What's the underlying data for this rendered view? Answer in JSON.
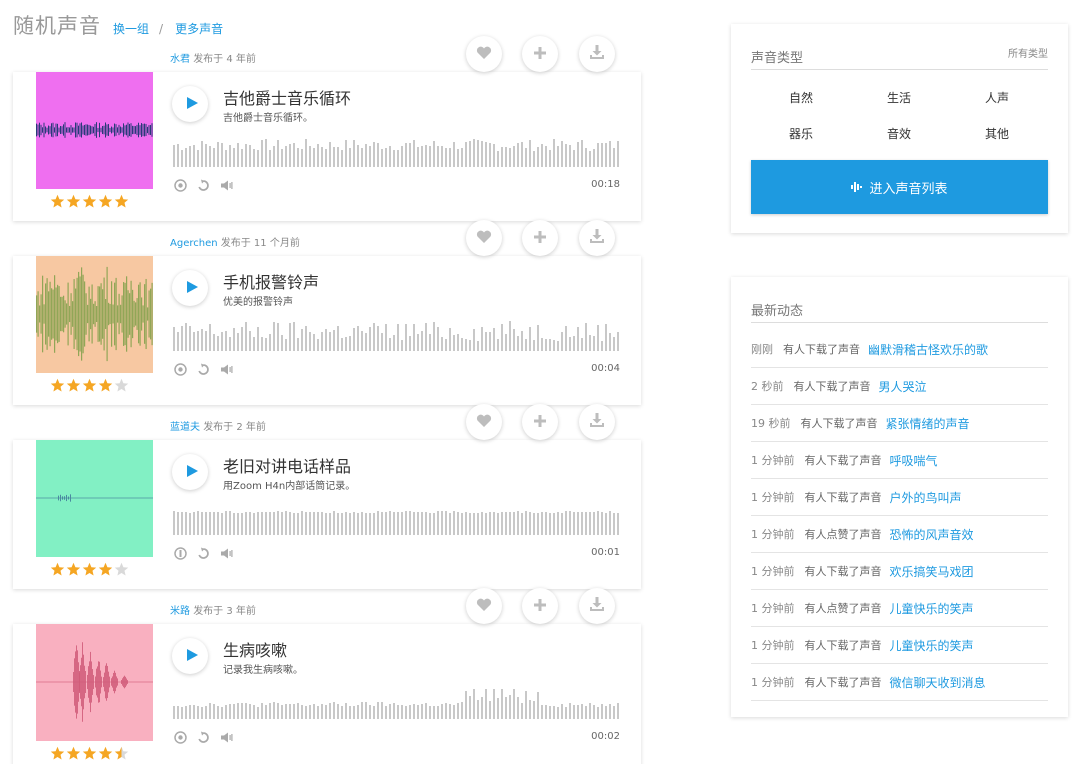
{
  "header": {
    "title": "随机声音",
    "switch_label": "换一组",
    "separator": "/",
    "more_label": "更多声音"
  },
  "sounds": [
    {
      "author": "水君",
      "published": "发布于 4 年前",
      "title": "吉他爵士音乐循环",
      "desc": "吉他爵士音乐循环。",
      "duration": "00:18",
      "rating": 5,
      "thumb_bg": "#ef6ff0",
      "wave_color": "#2a3a7a",
      "thumb_style": "flatline",
      "license_icon": "creative-commons-icon"
    },
    {
      "author": "Agerchen",
      "published": "发布于 11 个月前",
      "title": "手机报警铃声",
      "desc": "优美的报警铃声",
      "duration": "00:04",
      "rating": 4,
      "thumb_bg": "#f7c8a2",
      "wave_color": "#7fa04a",
      "thumb_style": "dense",
      "license_icon": "creative-commons-icon"
    },
    {
      "author": "蓝道夫",
      "published": "发布于 2 年前",
      "title": "老旧对讲电话样品",
      "desc": "用Zoom H4n内部话筒记录。",
      "duration": "00:01",
      "rating": 4,
      "thumb_bg": "#82f0c4",
      "wave_color": "#4a8aa0",
      "thumb_style": "thin",
      "license_icon": "attribution-icon"
    },
    {
      "author": "米路",
      "published": "发布于 3 年前",
      "title": "生病咳嗽",
      "desc": "记录我生病咳嗽。",
      "duration": "00:02",
      "rating": 4.5,
      "thumb_bg": "#f9b0c0",
      "wave_color": "#d05a78",
      "thumb_style": "spikes",
      "license_icon": "creative-commons-icon"
    }
  ],
  "types_panel": {
    "title": "声音类型",
    "all_label": "所有类型",
    "types": [
      "自然",
      "生活",
      "人声",
      "器乐",
      "音效",
      "其他"
    ],
    "enter_label": "进入声音列表"
  },
  "activity_panel": {
    "title": "最新动态",
    "items": [
      {
        "time": "刚刚",
        "action": "有人下载了声音",
        "sound": "幽默滑稽古怪欢乐的歌"
      },
      {
        "time": "2 秒前",
        "action": "有人下载了声音",
        "sound": "男人哭泣"
      },
      {
        "time": "19 秒前",
        "action": "有人下载了声音",
        "sound": "紧张情绪的声音"
      },
      {
        "time": "1 分钟前",
        "action": "有人下载了声音",
        "sound": "呼吸喘气"
      },
      {
        "time": "1 分钟前",
        "action": "有人下载了声音",
        "sound": "户外的鸟叫声"
      },
      {
        "time": "1 分钟前",
        "action": "有人点赞了声音",
        "sound": "恐怖的风声音效"
      },
      {
        "time": "1 分钟前",
        "action": "有人下载了声音",
        "sound": "欢乐搞笑马戏团"
      },
      {
        "time": "1 分钟前",
        "action": "有人点赞了声音",
        "sound": "儿童快乐的笑声"
      },
      {
        "time": "1 分钟前",
        "action": "有人下载了声音",
        "sound": "儿童快乐的笑声"
      },
      {
        "time": "1 分钟前",
        "action": "有人下载了声音",
        "sound": "微信聊天收到消息"
      }
    ]
  },
  "colors": {
    "accent": "#1e9ae0",
    "star": "#f5a623",
    "star_empty": "#d9d9d9",
    "wave_bar": "#c8c8c8"
  }
}
